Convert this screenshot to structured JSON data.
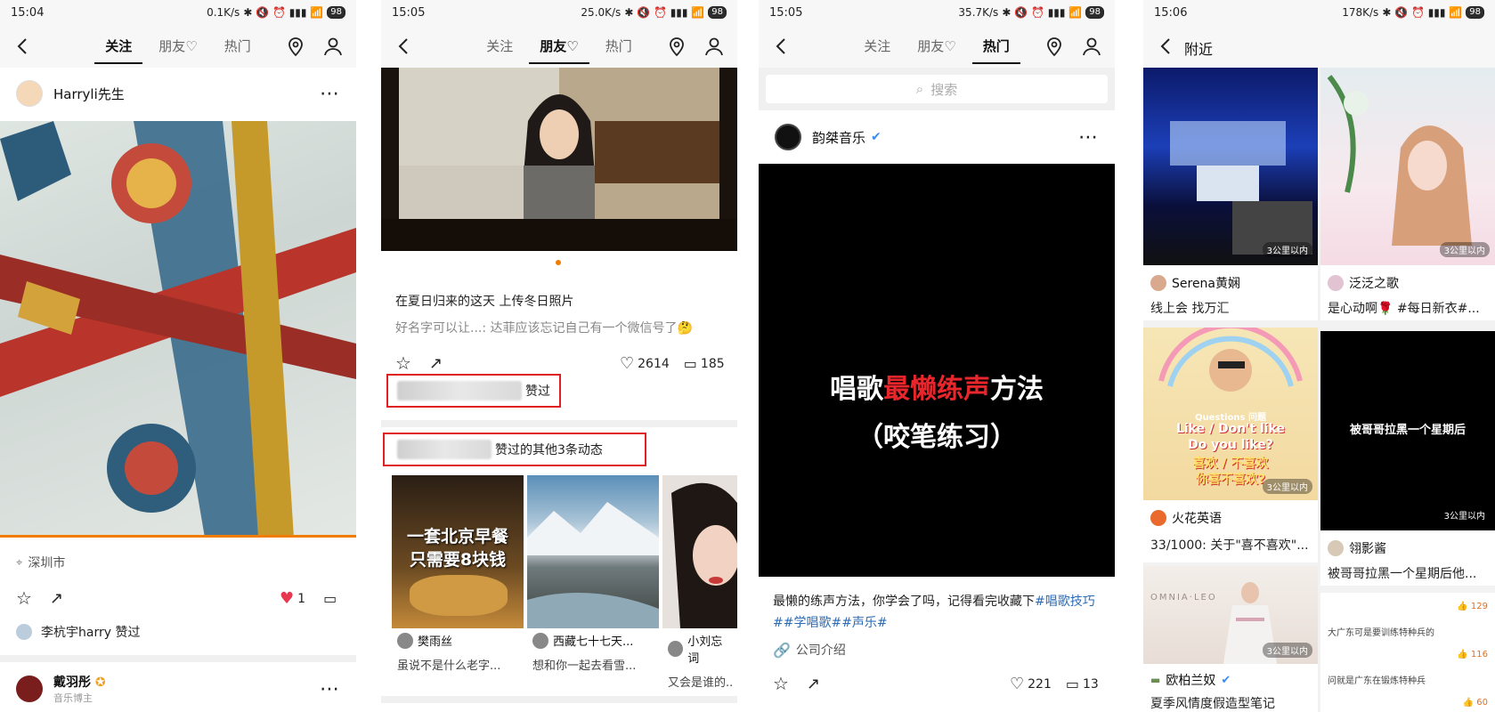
{
  "phone1": {
    "status": {
      "time": "15:04",
      "net": "0.1K/s",
      "battery": "98"
    },
    "tabs": [
      "关注",
      "朋友♡",
      "热门"
    ],
    "post": {
      "author": "Harryli先生",
      "location": "深圳市",
      "likes": "1",
      "liked_by": "李杭宇harry 赞过"
    },
    "next_post": {
      "author": "戴羽彤",
      "role": "音乐博主"
    }
  },
  "phone2": {
    "status": {
      "time": "15:05",
      "net": "25.0K/s",
      "battery": "98"
    },
    "tabs": [
      "关注",
      "朋友♡",
      "热门"
    ],
    "post": {
      "caption": "在夏日归来的这天 上传冬日照片",
      "comment": "好名字可以让...: 达菲应该忘记自己有一个微信号了🤔",
      "likes": "2614",
      "comments": "185",
      "liked_suffix": "赞过"
    },
    "group_title_suffix": "赞过的其他3条动态",
    "thumbs": [
      {
        "overlay_line1": "一套北京早餐",
        "overlay_line2": "只需要8块钱",
        "name": "樊雨丝",
        "desc": "虽说不是什么老字..."
      },
      {
        "overlay_line1": "",
        "overlay_line2": "",
        "name": "西藏七十七天...",
        "desc": "想和你一起去看雪..."
      },
      {
        "overlay_line1": "",
        "overlay_line2": "",
        "name": "小刘忘词",
        "desc": "又会是谁的..."
      }
    ]
  },
  "phone3": {
    "status": {
      "time": "15:05",
      "net": "35.7K/s",
      "battery": "98"
    },
    "tabs": [
      "关注",
      "朋友♡",
      "热门"
    ],
    "search_placeholder": "搜索",
    "post": {
      "author": "韵桀音乐",
      "video_line1_a": "唱歌",
      "video_line1_b": "最懒练声",
      "video_line1_c": "方法",
      "video_line2": "（咬笔练习）",
      "desc_a": "最懒的练声方法，你学会了吗，记得看完收藏下",
      "desc_tags": "#唱歌技巧##学唱歌##声乐#",
      "link": "公司介绍",
      "likes": "221",
      "comments": "13"
    }
  },
  "phone4": {
    "status": {
      "time": "15:06",
      "net": "178K/s",
      "battery": "98"
    },
    "title": "附近",
    "cards": [
      {
        "name": "Serena黄娴",
        "desc": "线上会 找万汇",
        "dist": "3公里以内"
      },
      {
        "name": "泛泛之歌",
        "desc": "是心动啊🌹 #每日新衣#...",
        "dist": "3公里以内"
      },
      {
        "name": "火花英语",
        "desc": "33/1000: 关于\"喜不喜欢\"...",
        "dist": "3公里以内",
        "overlay_a": "Questions 问题",
        "overlay_b": "Like / Don't like",
        "overlay_c": "Do you like?",
        "overlay_d": "喜欢 / 不喜欢",
        "overlay_e": "你喜不喜欢?"
      },
      {
        "name": "翎影酱",
        "desc": "被哥哥拉黑一个星期后他...",
        "dist": "3公里以内",
        "overlay": "被哥哥拉黑一个星期后"
      },
      {
        "name": "欧柏兰奴",
        "desc": "夏季风情度假造型笔记",
        "dist": "3公里以内",
        "overlay": "OMNIA·LEO"
      },
      {
        "comment1": "大广东可是要训练特种兵的",
        "count1": "129",
        "comment2": "问就是广东在锻炼特种兵",
        "count2": "116",
        "count3": "60"
      }
    ]
  },
  "colors": {
    "accent": "#f07c00",
    "red_box": "#e02020",
    "verified": "#3b8cf0",
    "link": "#2c6bb5",
    "heart": "#e8384f"
  }
}
